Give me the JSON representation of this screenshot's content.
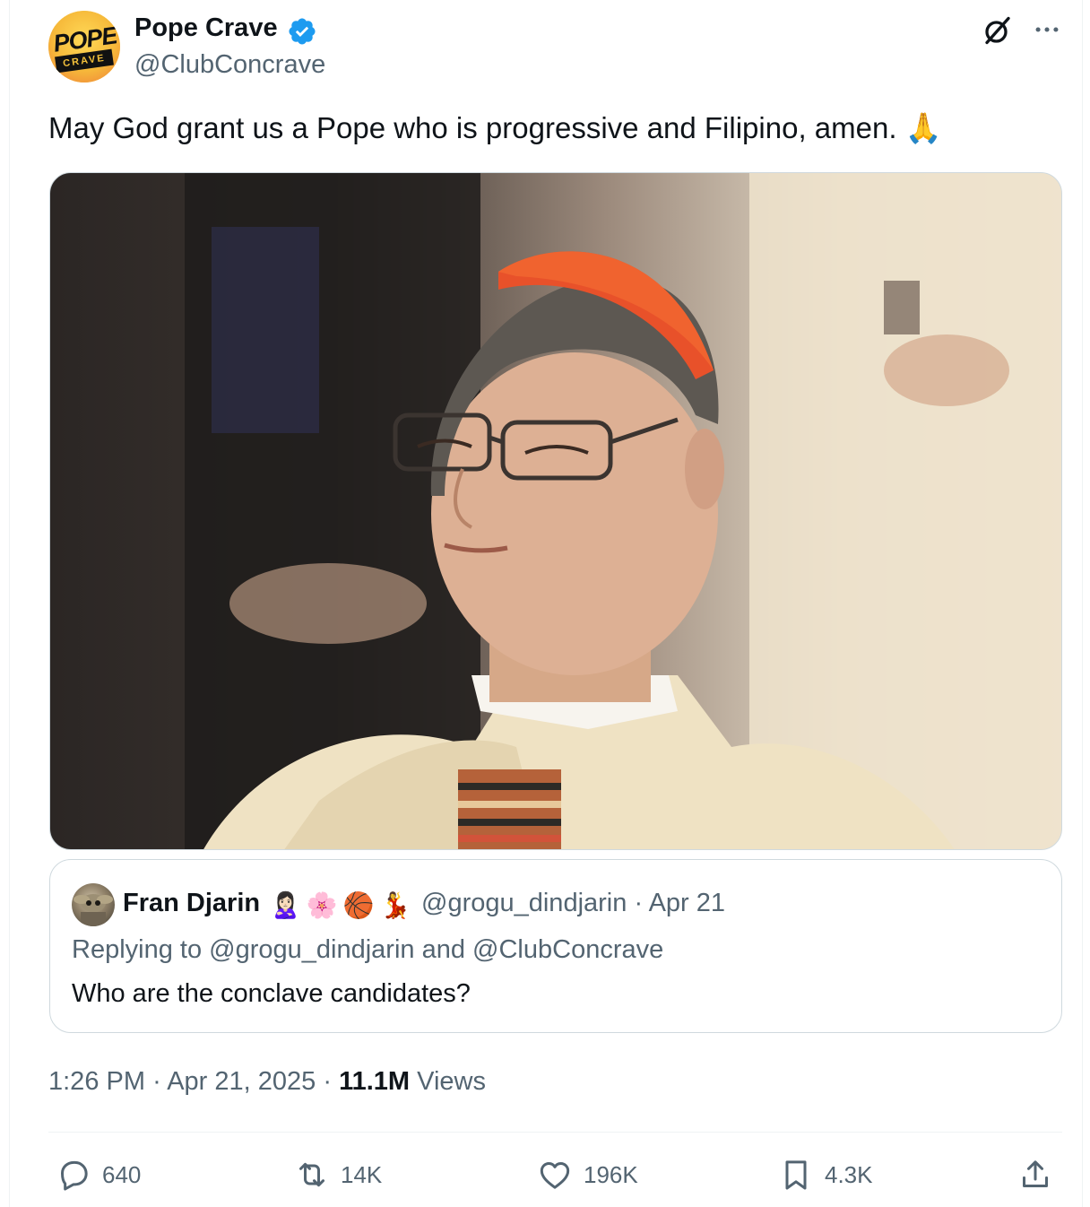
{
  "author": {
    "avatar_text_top": "POPE",
    "avatar_text_bottom": "CRAVE",
    "name": "Pope Crave",
    "handle": "@ClubConcrave"
  },
  "tweet": {
    "text": "May God grant us a Pope who is progressive and Filipino, amen. 🙏"
  },
  "quote": {
    "name": "Fran Djarin",
    "emojis": [
      "🙎🏻‍♀️",
      "🌸",
      "🏀",
      "💃"
    ],
    "handle": "@grogu_dindjarin",
    "date": "Apr 21",
    "reply_prefix": "Replying to",
    "reply_mention_1": "@grogu_dindjarin",
    "reply_and": "and",
    "reply_mention_2": "@ClubConcrave",
    "text": "Who are the conclave candidates?"
  },
  "meta": {
    "time": "1:26 PM",
    "date": "Apr 21, 2025",
    "views_count": "11.1M",
    "views_label": "Views"
  },
  "actions": {
    "replies": "640",
    "reposts": "14K",
    "likes": "196K",
    "bookmarks": "4.3K"
  },
  "colors": {
    "verified": "#1d9bf0",
    "secondary_text": "#536471",
    "primary_text": "#0f1419",
    "border": "#cfd9de"
  }
}
